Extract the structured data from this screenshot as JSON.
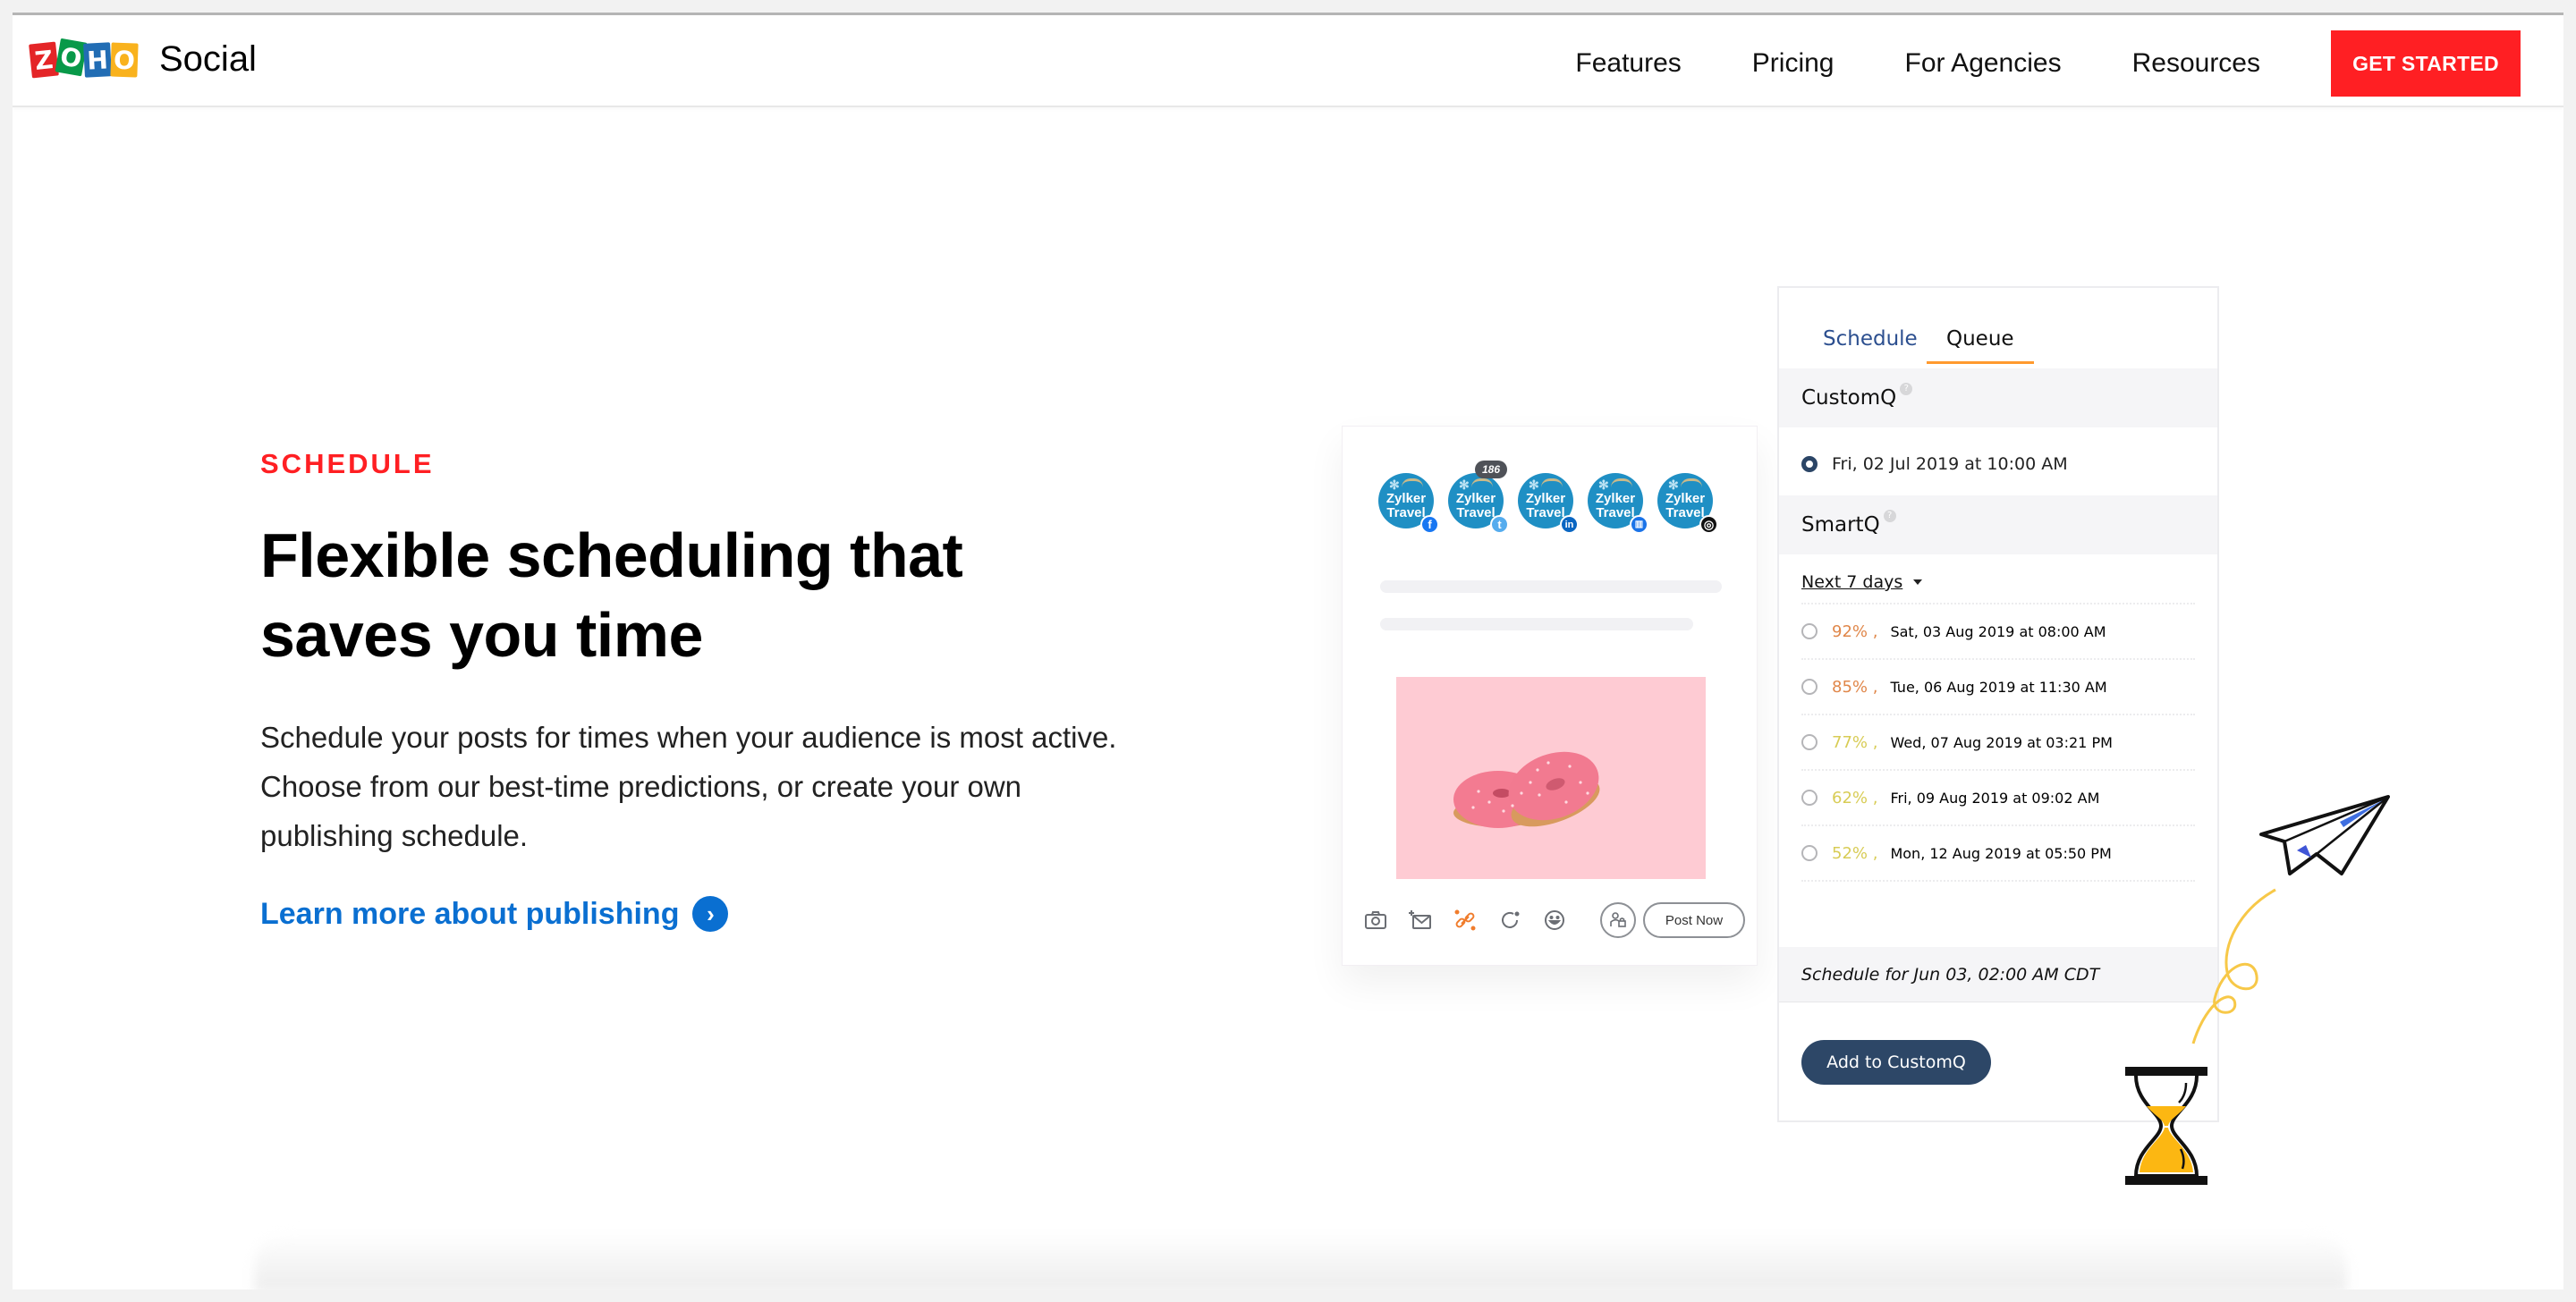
{
  "brand": {
    "logo_letters": [
      "Z",
      "O",
      "H",
      "O"
    ],
    "product_name": "Social",
    "accent_color": "#ff1f23",
    "link_color": "#0a6fd1"
  },
  "nav": {
    "links": [
      "Features",
      "Pricing",
      "For Agencies",
      "Resources"
    ],
    "cta_label": "GET STARTED"
  },
  "hero": {
    "eyebrow": "SCHEDULE",
    "headline": "Flexible scheduling that saves you time",
    "body": "Schedule your posts for times when your audience is most active. Choose from our best-time predictions, or create your own publishing schedule.",
    "link_label": "Learn more about publishing",
    "link_icon": "chevron-right-circle-icon"
  },
  "composer": {
    "accounts": [
      {
        "name": "Zylker Travel",
        "network": "facebook",
        "network_icon": "facebook-icon",
        "color": "#1877f2",
        "glyph": "f"
      },
      {
        "name": "Zylker Travel",
        "network": "twitter",
        "network_icon": "twitter-icon",
        "color": "#55acee",
        "glyph": "t",
        "count": "186"
      },
      {
        "name": "Zylker Travel",
        "network": "linkedin",
        "network_icon": "linkedin-icon",
        "color": "#0a66c2",
        "glyph": "in"
      },
      {
        "name": "Zylker Travel",
        "network": "google-my-business",
        "network_icon": "gmb-icon",
        "color": "#1a73e8",
        "glyph": "▥"
      },
      {
        "name": "Zylker Travel",
        "network": "instagram",
        "network_icon": "instagram-icon",
        "color": "#111111",
        "glyph": "◎"
      }
    ],
    "account_short": [
      "Zylker",
      "Travel"
    ],
    "image_alt": "Two pink sprinkled donuts",
    "toolbar_icons": [
      "camera-icon",
      "add-media-icon",
      "link-shortener-icon",
      "refresh-icon",
      "emoji-icon"
    ],
    "lock_icon": "user-lock-icon",
    "post_now_label": "Post Now"
  },
  "schedule_panel": {
    "tabs": [
      {
        "label": "Schedule",
        "active": false
      },
      {
        "label": "Queue",
        "active": true
      }
    ],
    "customq": {
      "title": "CustomQ",
      "help_icon": "?",
      "slots": [
        {
          "label": "Fri, 02 Jul 2019 at 10:00 AM",
          "selected": true
        }
      ]
    },
    "smartq": {
      "title": "SmartQ",
      "help_icon": "?",
      "range_label": "Next 7 days",
      "slots": [
        {
          "score": "92%",
          "score_color": "#e0874a",
          "label": "Sat, 03 Aug 2019 at 08:00 AM",
          "selected": false
        },
        {
          "score": "85%",
          "score_color": "#e0874a",
          "label": "Tue, 06 Aug 2019 at 11:30 AM",
          "selected": false
        },
        {
          "score": "77%",
          "score_color": "#d8cc55",
          "label": "Wed, 07 Aug 2019 at 03:21 PM",
          "selected": false
        },
        {
          "score": "62%",
          "score_color": "#d8cc55",
          "label": "Fri, 09 Aug 2019 at 09:02 AM",
          "selected": false
        },
        {
          "score": "52%",
          "score_color": "#d8cc55",
          "label": "Mon, 12 Aug 2019 at 05:50 PM",
          "selected": false
        }
      ]
    },
    "schedule_note": "Schedule for Jun 03, 02:00 AM  CDT",
    "add_button_label": "Add to CustomQ",
    "active_tab_color": "#ff9a2e",
    "button_color": "#2d4767"
  },
  "illustrations": [
    "paper-plane-icon",
    "hourglass-icon"
  ]
}
